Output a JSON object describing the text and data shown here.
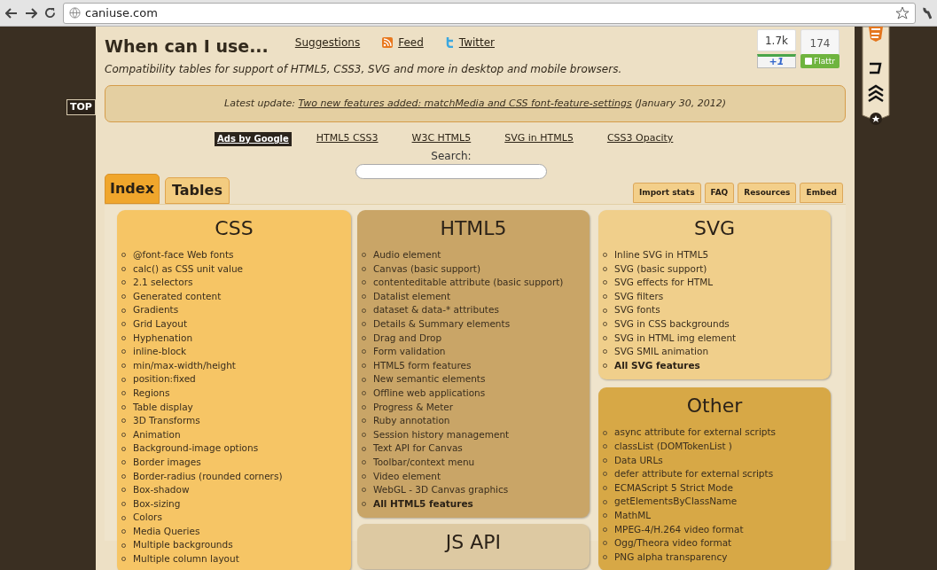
{
  "browser": {
    "url": "caniuse.com"
  },
  "top_button": "TOP",
  "header": {
    "title": "When can I use...",
    "links": [
      {
        "kind": "plain",
        "label": "Suggestions"
      },
      {
        "kind": "feed",
        "label": "Feed"
      },
      {
        "kind": "twitter",
        "label": "Twitter"
      }
    ],
    "subtitle": "Compatibility tables for support of HTML5, CSS3, SVG and more in desktop and mobile browsers.",
    "counts": [
      "1.7k",
      "174"
    ],
    "plus_one": "+1",
    "flattr": "Flattr"
  },
  "update": {
    "prefix": "Latest update:",
    "link": "Two new features added: matchMedia and CSS font-feature-settings",
    "suffix": "(January 30, 2012)"
  },
  "ads": {
    "label": "Ads by Google",
    "links": [
      "HTML5 CSS3",
      "W3C HTML5",
      "SVG in HTML5",
      "CSS3 Opacity"
    ]
  },
  "search": {
    "label": "Search:"
  },
  "tabs": [
    {
      "label": "Index",
      "selected": true
    },
    {
      "label": "Tables",
      "selected": false
    }
  ],
  "tools": [
    "Import stats",
    "FAQ",
    "Resources",
    "Embed"
  ],
  "columns": [
    [
      {
        "title": "CSS",
        "color": "#f6c565",
        "items": [
          {
            "text": "@font-face Web fonts",
            "bold": false
          },
          {
            "text": "calc() as CSS unit value",
            "bold": false
          },
          {
            "text": "2.1 selectors",
            "bold": false
          },
          {
            "text": "Generated content",
            "bold": false
          },
          {
            "text": "Gradients",
            "bold": false
          },
          {
            "text": "Grid Layout",
            "bold": false
          },
          {
            "text": "Hyphenation",
            "bold": false
          },
          {
            "text": "inline-block",
            "bold": false
          },
          {
            "text": "min/max-width/height",
            "bold": false
          },
          {
            "text": "position:fixed",
            "bold": false
          },
          {
            "text": "Regions",
            "bold": false
          },
          {
            "text": "Table display",
            "bold": false
          },
          {
            "text": "3D Transforms",
            "bold": false
          },
          {
            "text": "Animation",
            "bold": false
          },
          {
            "text": "Background-image options",
            "bold": false
          },
          {
            "text": "Border images",
            "bold": false
          },
          {
            "text": "Border-radius (rounded corners)",
            "bold": false
          },
          {
            "text": "Box-shadow",
            "bold": false
          },
          {
            "text": "Box-sizing",
            "bold": false
          },
          {
            "text": "Colors",
            "bold": false
          },
          {
            "text": "Media Queries",
            "bold": false
          },
          {
            "text": "Multiple backgrounds",
            "bold": false
          },
          {
            "text": "Multiple column layout",
            "bold": false
          }
        ]
      }
    ],
    [
      {
        "title": "HTML5",
        "color": "#c9a567",
        "items": [
          {
            "text": "Audio element",
            "bold": false
          },
          {
            "text": "Canvas (basic support)",
            "bold": false
          },
          {
            "text": "contenteditable attribute (basic support)",
            "bold": false
          },
          {
            "text": "Datalist element",
            "bold": false
          },
          {
            "text": "dataset & data-* attributes",
            "bold": false
          },
          {
            "text": "Details & Summary elements",
            "bold": false
          },
          {
            "text": "Drag and Drop",
            "bold": false
          },
          {
            "text": "Form validation",
            "bold": false
          },
          {
            "text": "HTML5 form features",
            "bold": false
          },
          {
            "text": "New semantic elements",
            "bold": false
          },
          {
            "text": "Offline web applications",
            "bold": false
          },
          {
            "text": "Progress & Meter",
            "bold": false
          },
          {
            "text": "Ruby annotation",
            "bold": false
          },
          {
            "text": "Session history management",
            "bold": false
          },
          {
            "text": "Text API for Canvas",
            "bold": false
          },
          {
            "text": "Toolbar/context menu",
            "bold": false
          },
          {
            "text": "Video element",
            "bold": false
          },
          {
            "text": "WebGL - 3D Canvas graphics",
            "bold": false
          },
          {
            "text": "All HTML5 features",
            "bold": true
          }
        ]
      },
      {
        "title": "JS API",
        "color": "#ddc9a2"
      }
    ],
    [
      {
        "title": "SVG",
        "color": "#f0cf8b",
        "items": [
          {
            "text": "Inline SVG in HTML5",
            "bold": false
          },
          {
            "text": "SVG (basic support)",
            "bold": false
          },
          {
            "text": "SVG effects for HTML",
            "bold": false
          },
          {
            "text": "SVG filters",
            "bold": false
          },
          {
            "text": "SVG fonts",
            "bold": false
          },
          {
            "text": "SVG in CSS backgrounds",
            "bold": false
          },
          {
            "text": "SVG in HTML img element",
            "bold": false
          },
          {
            "text": "SVG SMIL animation",
            "bold": false
          },
          {
            "text": "All SVG features",
            "bold": true
          }
        ]
      },
      {
        "title": "Other",
        "color": "#d7a846",
        "items": [
          {
            "text": "async attribute for external scripts",
            "bold": false
          },
          {
            "text": "classList (DOMTokenList )",
            "bold": false
          },
          {
            "text": "Data URLs",
            "bold": false
          },
          {
            "text": "defer attribute for external scripts",
            "bold": false
          },
          {
            "text": "ECMAScript 5 Strict Mode",
            "bold": false
          },
          {
            "text": "getElementsByClassName",
            "bold": false
          },
          {
            "text": "MathML",
            "bold": false
          },
          {
            "text": "MPEG-4/H.264 video format",
            "bold": false
          },
          {
            "text": "Ogg/Theora video format",
            "bold": false
          },
          {
            "text": "PNG alpha transparency",
            "bold": false
          }
        ]
      }
    ]
  ]
}
